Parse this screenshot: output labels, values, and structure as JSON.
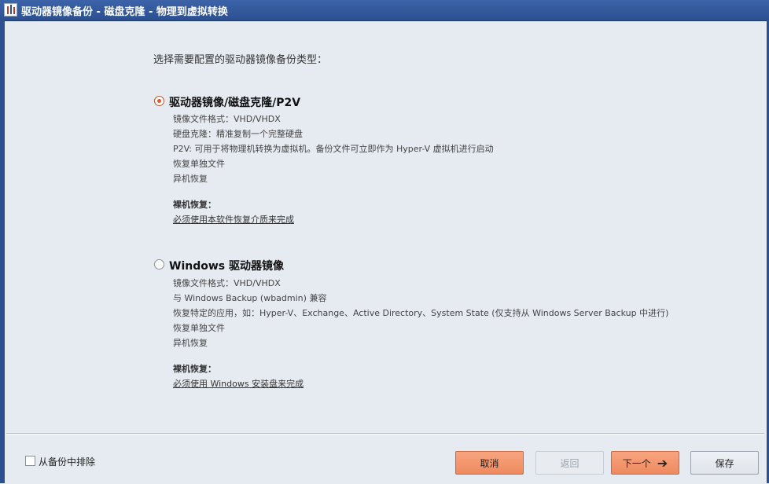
{
  "window": {
    "title": "驱动器镜像备份 - 磁盘克隆 - 物理到虚拟转换"
  },
  "prompt": "选择需要配置的驱动器镜像备份类型：",
  "options": [
    {
      "title": "驱动器镜像/磁盘克隆/P2V",
      "selected": true,
      "lines": [
        "镜像文件格式：VHD/VHDX",
        "硬盘克隆：精准复制一个完整硬盘",
        "P2V: 可用于将物理机转换为虚拟机。备份文件可立即作为 Hyper-V 虚拟机进行启动",
        "恢复单独文件",
        "异机恢复"
      ],
      "bmr_label": "裸机恢复：",
      "bmr_link": "必须使用本软件恢复介质来完成"
    },
    {
      "title": "Windows 驱动器镜像",
      "selected": false,
      "lines": [
        "镜像文件格式：VHD/VHDX",
        "与 Windows Backup (wbadmin) 兼容",
        "恢复特定的应用，如：Hyper-V、Exchange、Active Directory、System State (仅支持从 Windows Server Backup 中进行)",
        "恢复单独文件",
        "异机恢复"
      ],
      "bmr_label": "裸机恢复：",
      "bmr_link": "必须使用 Windows 安装盘来完成"
    }
  ],
  "footer": {
    "exclude_label": "从备份中排除",
    "cancel": "取消",
    "back": "返回",
    "next": "下一个",
    "save": "保存"
  },
  "icons": {
    "next_arrow": "arrow-right-icon"
  },
  "colors": {
    "accent": "#ef8a5f",
    "titlebar": "#2c4f90"
  }
}
